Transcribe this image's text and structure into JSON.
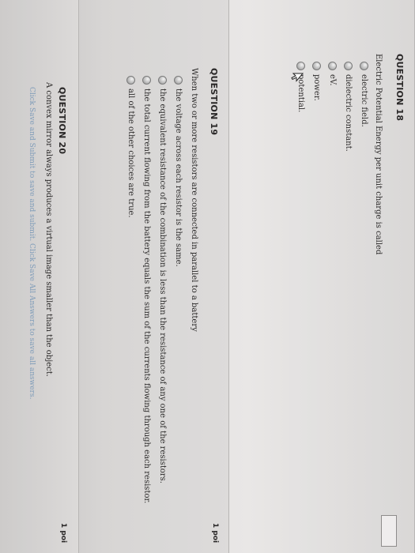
{
  "q18": {
    "title": "QUESTION 18",
    "text": "Electric Potential Energy per unit charge is called",
    "options": [
      "electric field.",
      "dielectric constant.",
      "eV.",
      "power.",
      "potential."
    ]
  },
  "q19": {
    "title": "QUESTION 19",
    "points": "1 poi",
    "text": "When two or more resistors are connected in parallel to a battery",
    "options": [
      "the voltage across each resistor is the same.",
      "the equivalent resistance of the combination is less than the resistance of any one of the resistors.",
      "the total current flowing from the battery equals the sum of the currents flowing through each resistor.",
      "all of the other choices are true."
    ]
  },
  "q20": {
    "title": "QUESTION 20",
    "points": "1 poi",
    "text": "A convex mirror always produces a virtual image smaller than the object."
  },
  "footer": {
    "text": "Click Save and Submit to save and submit. Click Save All Answers to save all answers."
  }
}
